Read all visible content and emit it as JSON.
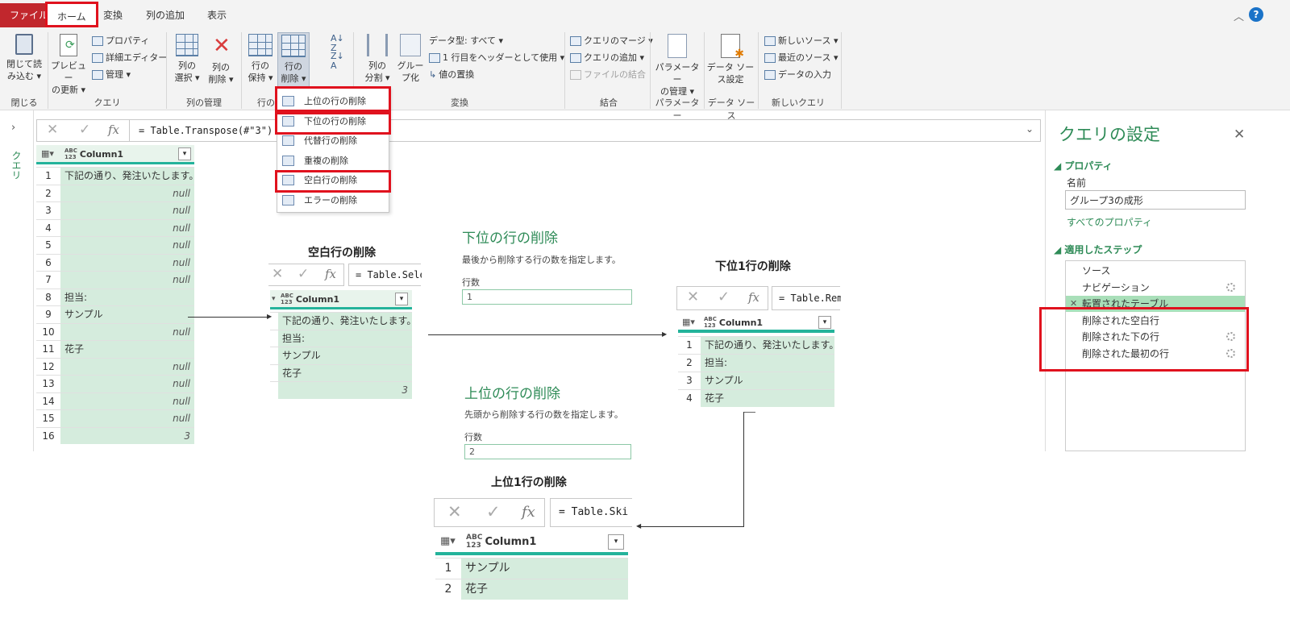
{
  "tabs": {
    "file": "ファイル",
    "home": "ホーム",
    "transform": "変換",
    "add_column": "列の追加",
    "view": "表示"
  },
  "ribbon": {
    "close_load": "閉じて読\nみ込む ▾",
    "preview_refresh": "プレビュー\nの更新 ▾",
    "properties": "プロパティ",
    "advanced_editor": "詳細エディター",
    "manage": "管理 ▾",
    "choose_columns": "列の\n選択 ▾",
    "remove_columns": "列の\n削除 ▾",
    "keep_rows": "行の\n保持 ▾",
    "remove_rows": "行の\n削除 ▾",
    "split_column": "列の\n分割 ▾",
    "group_by": "グルー\nプ化",
    "data_type": "データ型: すべて ▾",
    "use_first_row": "1 行目をヘッダーとして使用 ▾",
    "replace_values": "値の置換",
    "merge_queries": "クエリのマージ ▾",
    "append_queries": "クエリの追加 ▾",
    "combine_files": "ファイルの結合",
    "manage_params": "パラメーター\nの管理 ▾",
    "datasource_settings": "データ ソー\nス設定",
    "new_source": "新しいソース ▾",
    "recent_sources": "最近のソース ▾",
    "enter_data": "データの入力",
    "groups": {
      "close": "閉じる",
      "query": "クエリ",
      "manage_columns": "列の管理",
      "reduce_rows": "行の",
      "sort": "",
      "transform": "変換",
      "combine": "結合",
      "parameters": "パラメーター",
      "datasources": "データ ソース",
      "new_query": "新しいクエリ"
    }
  },
  "remove_rows_menu": [
    "上位の行の削除",
    "下位の行の削除",
    "代替行の削除",
    "重複の削除",
    "空白行の削除",
    "エラーの削除"
  ],
  "queries_label": "クエリ",
  "formula_main": "= Table.Transpose(#\"3\")",
  "fx": "fx",
  "column1": "Column1",
  "abc": "ABC\n123",
  "main_table": {
    "rows": [
      {
        "n": "1",
        "v": "下記の通り、発注いたします。",
        "r": false
      },
      {
        "n": "2",
        "v": "null",
        "r": true
      },
      {
        "n": "3",
        "v": "null",
        "r": true
      },
      {
        "n": "4",
        "v": "null",
        "r": true
      },
      {
        "n": "5",
        "v": "null",
        "r": true
      },
      {
        "n": "6",
        "v": "null",
        "r": true
      },
      {
        "n": "7",
        "v": "null",
        "r": true
      },
      {
        "n": "8",
        "v": "担当:",
        "r": false
      },
      {
        "n": "9",
        "v": "サンプル",
        "r": false
      },
      {
        "n": "10",
        "v": "null",
        "r": true
      },
      {
        "n": "11",
        "v": "花子",
        "r": false
      },
      {
        "n": "12",
        "v": "null",
        "r": true
      },
      {
        "n": "13",
        "v": "null",
        "r": true
      },
      {
        "n": "14",
        "v": "null",
        "r": true
      },
      {
        "n": "15",
        "v": "null",
        "r": true
      },
      {
        "n": "16",
        "v": "3",
        "r": true
      }
    ]
  },
  "blank_removed": {
    "heading": "空白行の削除",
    "formula": "= Table.Sele",
    "rows": [
      {
        "v": "下記の通り、発注いたします。",
        "r": false
      },
      {
        "v": "担当:",
        "r": false
      },
      {
        "v": "サンプル",
        "r": false
      },
      {
        "v": "花子",
        "r": false
      },
      {
        "v": "3",
        "r": true
      }
    ]
  },
  "bottom_dialog": {
    "title": "下位の行の削除",
    "desc": "最後から削除する行の数を指定します。",
    "label": "行数",
    "value": "1"
  },
  "top_dialog": {
    "title": "上位の行の削除",
    "desc": "先頭から削除する行の数を指定します。",
    "label": "行数",
    "value": "2"
  },
  "bottom1": {
    "heading": "下位1行の削除",
    "formula": "= Table.Rem",
    "rows": [
      {
        "n": "1",
        "v": "下記の通り、発注いたします。"
      },
      {
        "n": "2",
        "v": "担当:"
      },
      {
        "n": "3",
        "v": "サンプル"
      },
      {
        "n": "4",
        "v": "花子"
      }
    ]
  },
  "top1": {
    "heading": "上位1行の削除",
    "formula": "= Table.Ski",
    "rows": [
      {
        "n": "1",
        "v": "サンプル"
      },
      {
        "n": "2",
        "v": "花子"
      }
    ]
  },
  "settings": {
    "title": "クエリの設定",
    "properties": "プロパティ",
    "name_label": "名前",
    "name_value": "グループ3の成形",
    "all_properties": "すべてのプロパティ",
    "applied_steps": "適用したステップ",
    "steps": [
      "ソース",
      "ナビゲーション",
      "転置されたテーブル",
      "削除された空白行",
      "削除された下の行",
      "削除された最初の行"
    ]
  },
  "colors": {
    "file_tab": "#c1272d",
    "highlight": "#e0121e",
    "accent_green": "#2e8b57",
    "cell_green": "#d5ecdd",
    "teal": "#24b39b"
  }
}
